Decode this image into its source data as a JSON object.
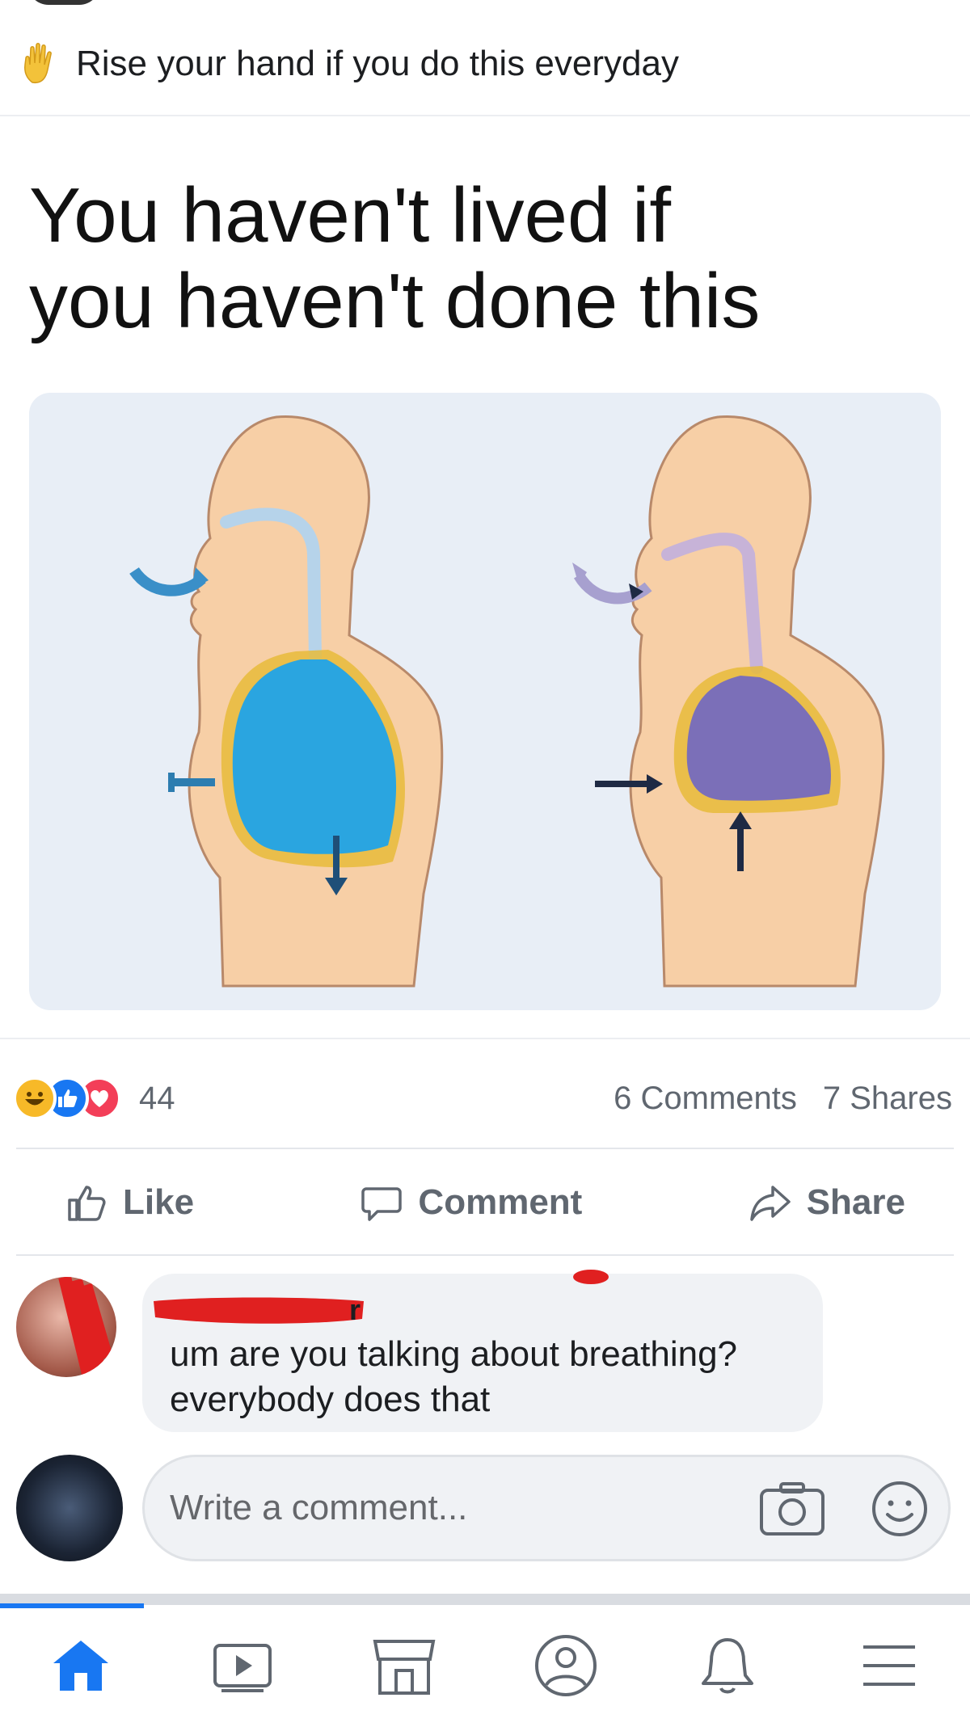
{
  "post": {
    "caption": "Rise your hand if you do this everyday",
    "headline_line1": "You haven't lived if",
    "headline_line2": "you haven't done this"
  },
  "reactions": {
    "types": [
      "haha-icon",
      "like-icon",
      "love-icon"
    ],
    "count": "44",
    "comments": "6 Comments",
    "shares": "7 Shares"
  },
  "actions": {
    "like": "Like",
    "comment": "Comment",
    "share": "Share"
  },
  "comment": {
    "author": "r",
    "text": "um are you talking about breathing? everybody does that"
  },
  "composer": {
    "placeholder": "Write a comment..."
  },
  "colors": {
    "accent": "#1877f2",
    "inhale_lung": "#2aa5e0",
    "exhale_lung": "#7b6fb8",
    "skin": "#f7cfa6"
  },
  "nav": [
    "home-icon",
    "video-icon",
    "marketplace-icon",
    "profile-icon",
    "notifications-icon",
    "menu-icon"
  ]
}
